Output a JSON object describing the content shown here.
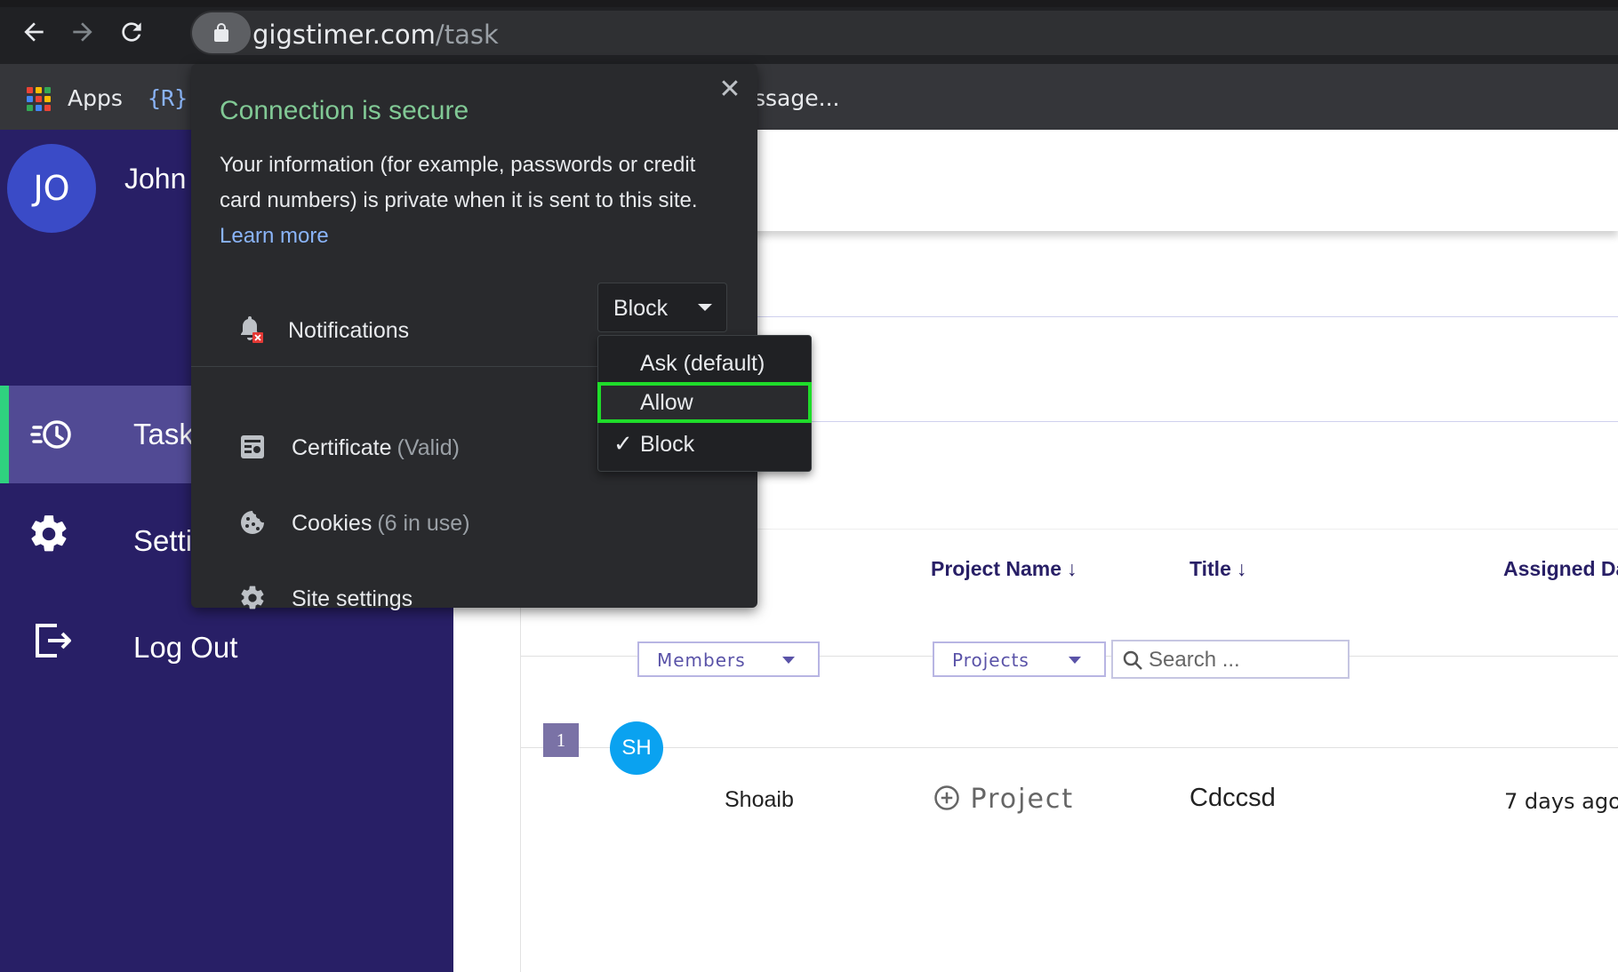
{
  "browser": {
    "url_domain": "gigstimer.com",
    "url_path": "/task",
    "bookmarks": {
      "apps_label": "Apps",
      "icon_text": "{R}",
      "truncated_label": "ssage..."
    }
  },
  "sidebar": {
    "avatar_initials": "JO",
    "user_name": "John",
    "items": [
      {
        "label": "Task",
        "icon": "task-clock-icon",
        "active": true
      },
      {
        "label": "Settings",
        "icon": "gear-icon",
        "active": false
      },
      {
        "label": "Log Out",
        "icon": "logout-icon",
        "active": false
      }
    ]
  },
  "table": {
    "headers": {
      "project_name": "Project Name",
      "title": "Title",
      "assigned_date": "Assigned Date",
      "sort_arrow": "↓"
    },
    "filters": {
      "members": "Members",
      "projects": "Projects",
      "search_placeholder": "Search ..."
    },
    "rows": [
      {
        "num": "1",
        "initials": "SH",
        "member": "Shoaib",
        "project": "Project",
        "title": "Cdccsd",
        "assigned": "7 days ago"
      }
    ]
  },
  "popup": {
    "title": "Connection is secure",
    "desc_text": "Your information (for example, passwords or credit card numbers) is private when it is sent to this site.",
    "learn_more": "Learn more",
    "notifications_label": "Notifications",
    "notifications_value": "Block",
    "dropdown_options": [
      "Ask (default)",
      "Allow",
      "Block"
    ],
    "certificate_label": "Certificate",
    "certificate_status": "(Valid)",
    "cookies_label": "Cookies",
    "cookies_status": "(6 in use)",
    "site_settings_label": "Site settings",
    "close_glyph": "✕",
    "check_glyph": "✓"
  },
  "colors": {
    "sidebar_bg": "#281f66",
    "sidebar_active": "#514a94",
    "accent_green": "#2fd17f",
    "popup_bg": "#292a2d",
    "secure_green": "#81c995",
    "link_blue": "#8ab4f8",
    "highlight_green": "#1fdc2a"
  }
}
